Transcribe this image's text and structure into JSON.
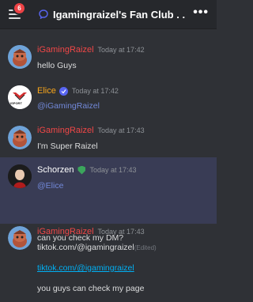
{
  "header": {
    "notification_count": "6",
    "title": "Igamingraizel's Fan Club . ."
  },
  "messages": [
    {
      "author": "iGamingRaizel",
      "time": "Today at 17:42",
      "text": "hello Guys",
      "author_color": "#f04747"
    },
    {
      "author": "Elice",
      "time": "Today at 17:42",
      "mention": "@iGamingRaizel",
      "author_color": "#faa61a"
    },
    {
      "author": "iGamingRaizel",
      "time": "Today at 17:43",
      "text": "I'm Super Raizel",
      "author_color": "#f04747"
    },
    {
      "author": "Schorzen",
      "time": "Today at 17:43",
      "mention": "@Elice",
      "text2": "can you check my DM?",
      "author_color": "#ffffff"
    },
    {
      "author": "iGamingRaizel",
      "time": "Today at 17:43",
      "text": "tiktok.com/@igamingraizel",
      "edited": "(Edited)",
      "link": "tiktok.com/@igamingraizel",
      "text3": "you guys can check my page",
      "author_color": "#f04747"
    }
  ],
  "avatars": {
    "elice_logo_text": "ISPORT"
  },
  "colors": {
    "background": "#2f3136",
    "header": "#26282c",
    "highlight": "#393c55",
    "mention": "#7289da",
    "link": "#00b0f4"
  }
}
